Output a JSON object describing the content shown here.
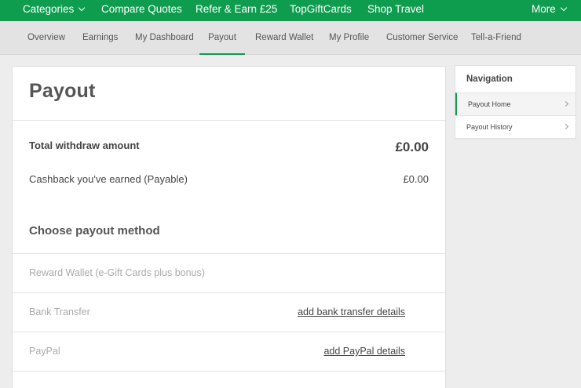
{
  "topnav": {
    "categories": "Categories",
    "compare_quotes": "Compare Quotes",
    "refer_earn": "Refer & Earn £25",
    "topgiftcards": "TopGiftCards",
    "shop_travel": "Shop Travel",
    "more": "More"
  },
  "subnav": {
    "tabs": [
      {
        "label": "Overview"
      },
      {
        "label": "Earnings"
      },
      {
        "label": "My Dashboard"
      },
      {
        "label": "Payout"
      },
      {
        "label": "Reward Wallet"
      },
      {
        "label": "My Profile"
      },
      {
        "label": "Customer Service"
      },
      {
        "label": "Tell-a-Friend"
      }
    ],
    "active": "Payout"
  },
  "main": {
    "title": "Payout",
    "total_label": "Total withdraw amount",
    "total_value": "£0.00",
    "cashback_label": "Cashback you've earned (Payable)",
    "cashback_value": "£0.00",
    "methods_title": "Choose payout method",
    "methods": [
      {
        "label": "Reward Wallet (e-Gift Cards plus bonus)",
        "action": ""
      },
      {
        "label": "Bank Transfer",
        "action": "add bank transfer details"
      },
      {
        "label": "PayPal",
        "action": "add PayPal details"
      }
    ]
  },
  "side_nav": {
    "title": "Navigation",
    "items": [
      {
        "label": "Payout Home"
      },
      {
        "label": "Payout History"
      }
    ]
  },
  "colors": {
    "brand_green": "#0e9d4f",
    "page_bg": "#ededed"
  }
}
